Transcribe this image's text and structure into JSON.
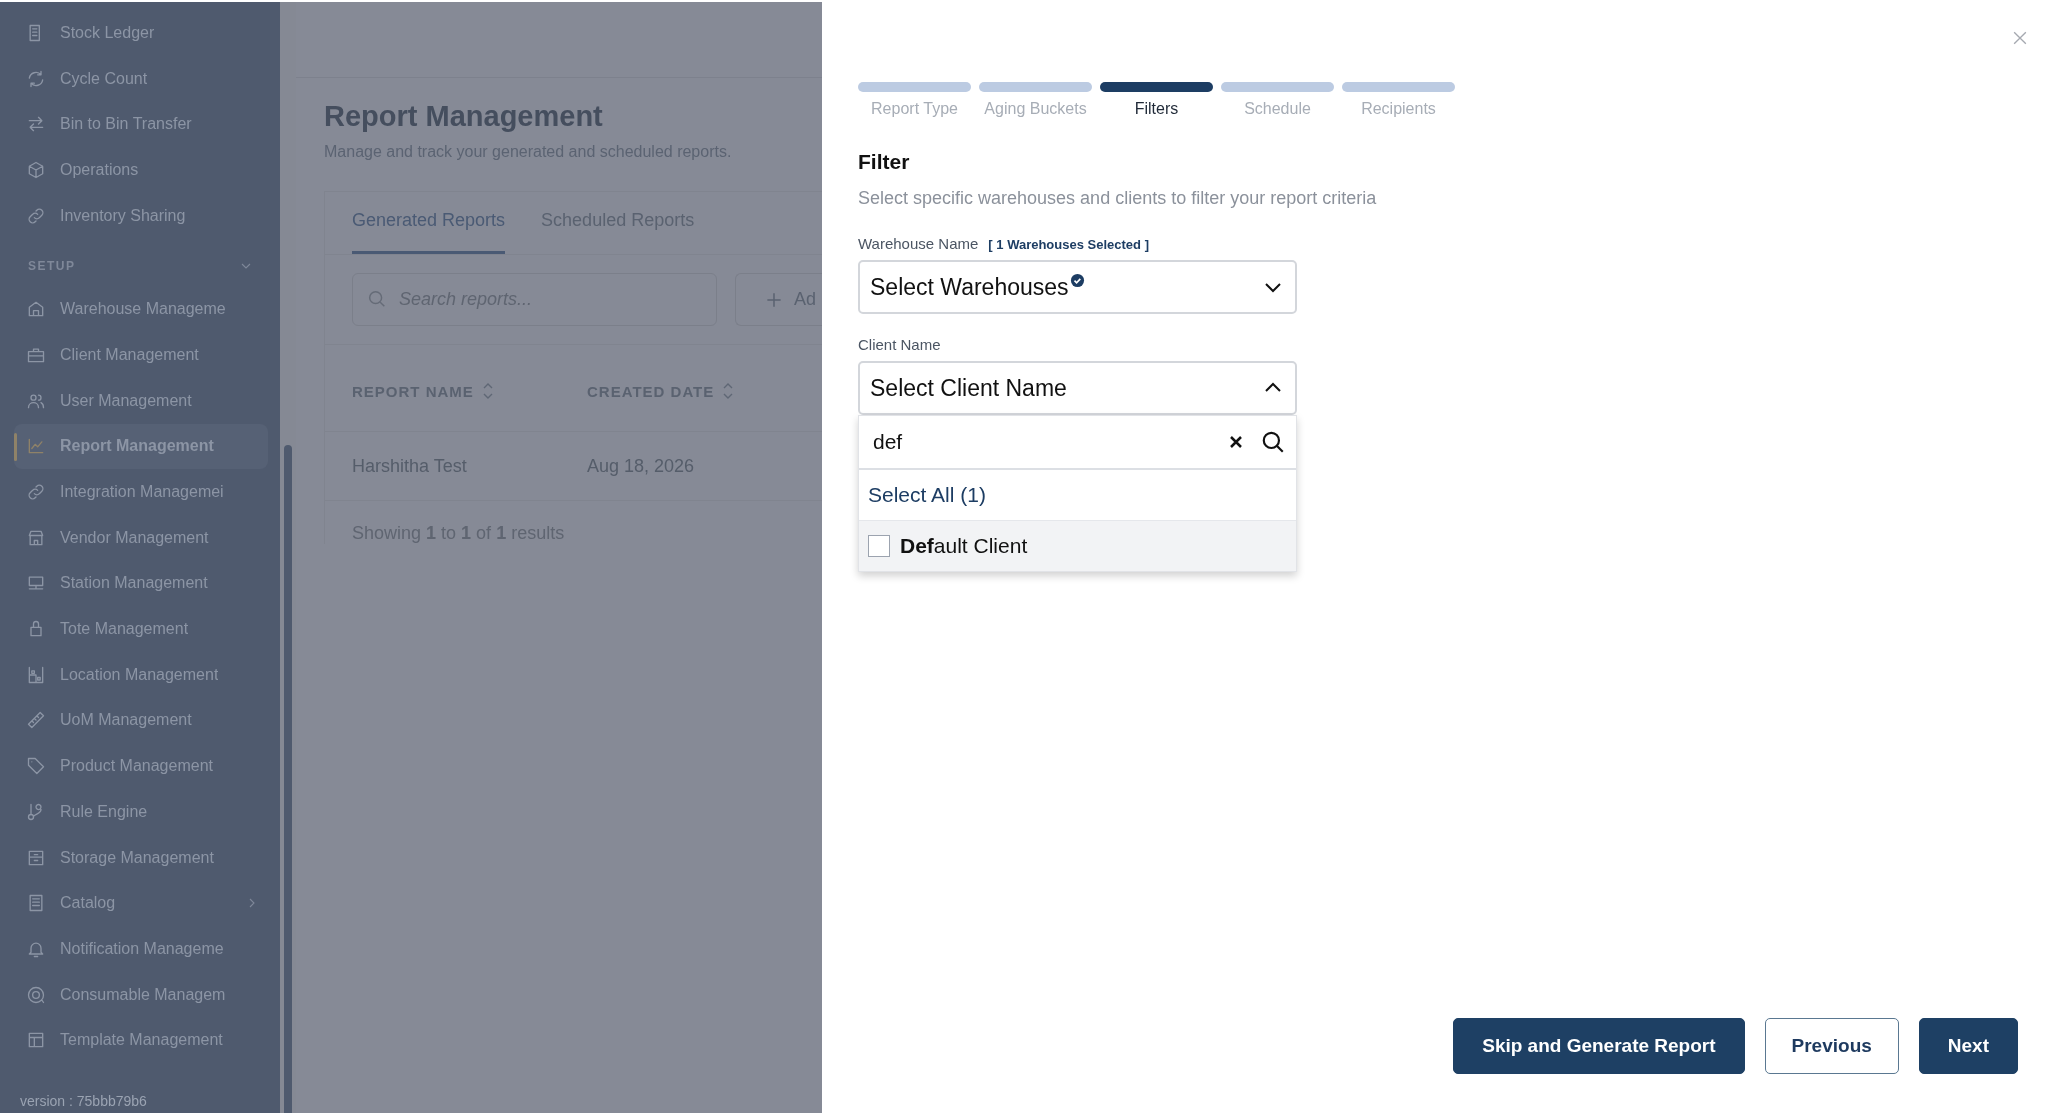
{
  "sidebar": {
    "items": [
      {
        "label": "Stock Ledger",
        "selected": false
      },
      {
        "label": "Cycle Count",
        "selected": false
      },
      {
        "label": "Bin to Bin Transfer",
        "selected": false
      },
      {
        "label": "Operations",
        "selected": false
      },
      {
        "label": "Inventory Sharing",
        "selected": false
      }
    ],
    "section": {
      "title": "SETUP",
      "expanded": true,
      "items": [
        {
          "label": "Warehouse Manageme",
          "selected": false,
          "submenu": false
        },
        {
          "label": "Client Management",
          "selected": false,
          "submenu": false
        },
        {
          "label": "User Management",
          "selected": false,
          "submenu": false
        },
        {
          "label": "Report Management",
          "selected": true,
          "submenu": false
        },
        {
          "label": "Integration Managemei",
          "selected": false,
          "submenu": false
        },
        {
          "label": "Vendor Management",
          "selected": false,
          "submenu": false
        },
        {
          "label": "Station Management",
          "selected": false,
          "submenu": false
        },
        {
          "label": "Tote Management",
          "selected": false,
          "submenu": false
        },
        {
          "label": "Location Management",
          "selected": false,
          "submenu": false
        },
        {
          "label": "UoM Management",
          "selected": false,
          "submenu": false
        },
        {
          "label": "Product Management",
          "selected": false,
          "submenu": false
        },
        {
          "label": "Rule Engine",
          "selected": false,
          "submenu": false
        },
        {
          "label": "Storage Management",
          "selected": false,
          "submenu": false
        },
        {
          "label": "Catalog",
          "selected": false,
          "submenu": true
        },
        {
          "label": "Notification Manageme",
          "selected": false,
          "submenu": false
        },
        {
          "label": "Consumable Managem",
          "selected": false,
          "submenu": false
        },
        {
          "label": "Template Management",
          "selected": false,
          "submenu": false
        }
      ]
    },
    "version": "version : 75bbb79b6"
  },
  "page": {
    "title": "Report Management",
    "subtitle": "Manage and track your generated and scheduled reports.",
    "tabs": [
      {
        "label": "Generated Reports",
        "selected": true
      },
      {
        "label": "Scheduled Reports",
        "selected": false
      }
    ],
    "search": {
      "placeholder": "Search reports..."
    },
    "add_button": "Ad",
    "table": {
      "columns": [
        "REPORT NAME",
        "CREATED DATE"
      ],
      "rows": [
        [
          "Harshitha Test",
          "Aug 18, 2026"
        ]
      ]
    },
    "pagination": "Showing **1** to **1** of **1** results"
  },
  "drawer": {
    "steps": [
      {
        "label": "Report Type",
        "selected": false
      },
      {
        "label": "Aging Buckets",
        "selected": false
      },
      {
        "label": "Filters",
        "selected": true
      },
      {
        "label": "Schedule",
        "selected": false
      },
      {
        "label": "Recipients",
        "selected": false
      }
    ],
    "heading": "Filter",
    "description": "Select specific warehouses and clients to filter your report criteria",
    "warehouse": {
      "label": "Warehouse Name",
      "count": "[ 1 Warehouses Selected ]",
      "value": "Select Warehouses",
      "has_selection": true,
      "expanded": false
    },
    "client": {
      "label": "Client Name",
      "value": "Select Client Name",
      "expanded": true,
      "search": "def",
      "select_all": "Select All (1)",
      "options": [
        {
          "label": "**Def**ault Client",
          "checked": false
        }
      ]
    },
    "buttons": [
      {
        "label": "Skip and Generate Report",
        "kind": "primary"
      },
      {
        "label": "Previous",
        "kind": "outline"
      },
      {
        "label": "Next",
        "kind": "primary"
      }
    ]
  }
}
